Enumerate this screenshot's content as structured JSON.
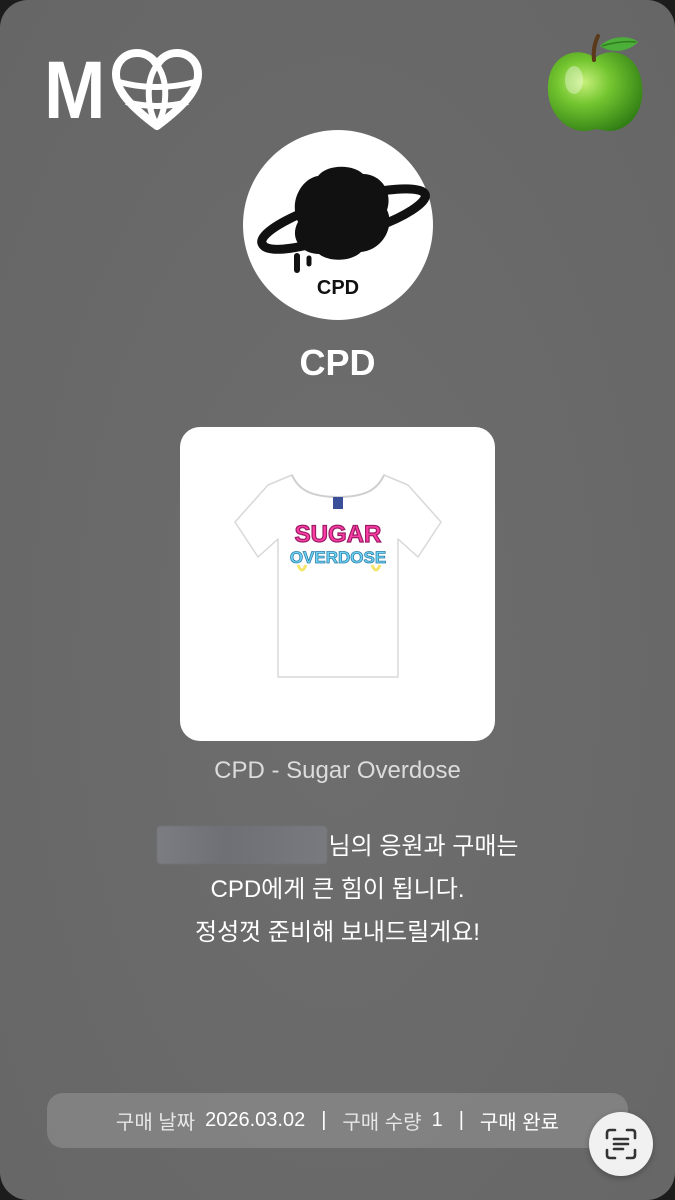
{
  "header": {
    "logo_letter": "M",
    "logo_icon": "globe-heart-icon",
    "apple_icon": "green-apple-icon"
  },
  "artist": {
    "avatar_label": "CPD",
    "name": "CPD"
  },
  "product": {
    "image_icon": "white-tshirt-icon",
    "shirt_print_line1": "SUGAR",
    "shirt_print_line2": "OVERDOSE",
    "title": "CPD - Sugar Overdose"
  },
  "message": {
    "line1_suffix": "님의 응원과 구매는",
    "line2": "CPD에게 큰 힘이 됩니다.",
    "line3": "정성껏 준비해 보내드릴게요!"
  },
  "purchase_info": {
    "date_label": "구매 날짜",
    "date_value": "2026.03.02",
    "qty_label": "구매 수량",
    "qty_value": "1",
    "status": "구매 완료",
    "separator": "|"
  },
  "scan_button": {
    "icon": "text-scan-icon"
  },
  "colors": {
    "background": "#6a6a6a",
    "card": "#ffffff",
    "apple_green": "#5cb82a",
    "print_pink": "#ff3ea5",
    "print_blue": "#6fd4f5"
  }
}
